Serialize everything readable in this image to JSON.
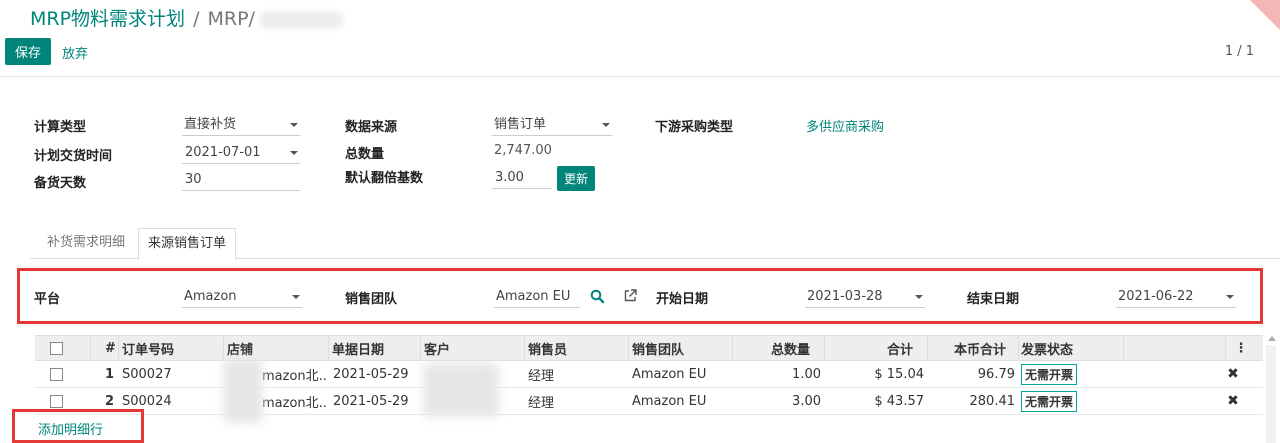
{
  "breadcrumb": {
    "title": "MRP物料需求计划",
    "separator": "/",
    "current": "MRP/"
  },
  "toolbar": {
    "save_label": "保存",
    "discard_label": "放弃",
    "pager": "1 / 1"
  },
  "form": {
    "calc_type_label": "计算类型",
    "calc_type_value": "直接补货",
    "delivery_time_label": "计划交货时间",
    "delivery_time_value": "2021-07-01",
    "stock_days_label": "备货天数",
    "stock_days_value": "30",
    "data_source_label": "数据来源",
    "data_source_value": "销售订单",
    "total_qty_label": "总数量",
    "total_qty_value": "2,747.00",
    "multiplier_label": "默认翻倍基数",
    "multiplier_value": "3.00",
    "update_label": "更新",
    "purchase_type_label": "下游采购类型",
    "purchase_type_value": "多供应商采购"
  },
  "tabs": [
    {
      "label": "补货需求明细"
    },
    {
      "label": "来源销售订单"
    }
  ],
  "filters": {
    "platform_label": "平台",
    "platform_value": "Amazon",
    "team_label": "销售团队",
    "team_value": "Amazon EU",
    "start_label": "开始日期",
    "start_value": "2021-03-28",
    "end_label": "结束日期",
    "end_value": "2021-06-22"
  },
  "table": {
    "headers": [
      "#",
      "订单号码",
      "店铺",
      "单据日期",
      "客户",
      "销售员",
      "销售团队",
      "总数量",
      "合计",
      "本币合计",
      "发票状态"
    ],
    "rows": [
      {
        "num": "1",
        "order": "S00027",
        "shop": "mazon北...",
        "date": "2021-05-29",
        "salesperson": "经理",
        "team": "Amazon EU",
        "qty": "1.00",
        "total": "$ 15.04",
        "local_total": "96.79",
        "invoice": "无需开票"
      },
      {
        "num": "2",
        "order": "S00024",
        "shop": "mazon北...",
        "date": "2021-05-29",
        "salesperson": "经理",
        "team": "Amazon EU",
        "qty": "3.00",
        "total": "$ 43.57",
        "local_total": "280.41",
        "invoice": "无需开票"
      }
    ],
    "add_line_label": "添加明细行"
  },
  "colors": {
    "accent": "#00857a",
    "highlight": "#e53935"
  }
}
